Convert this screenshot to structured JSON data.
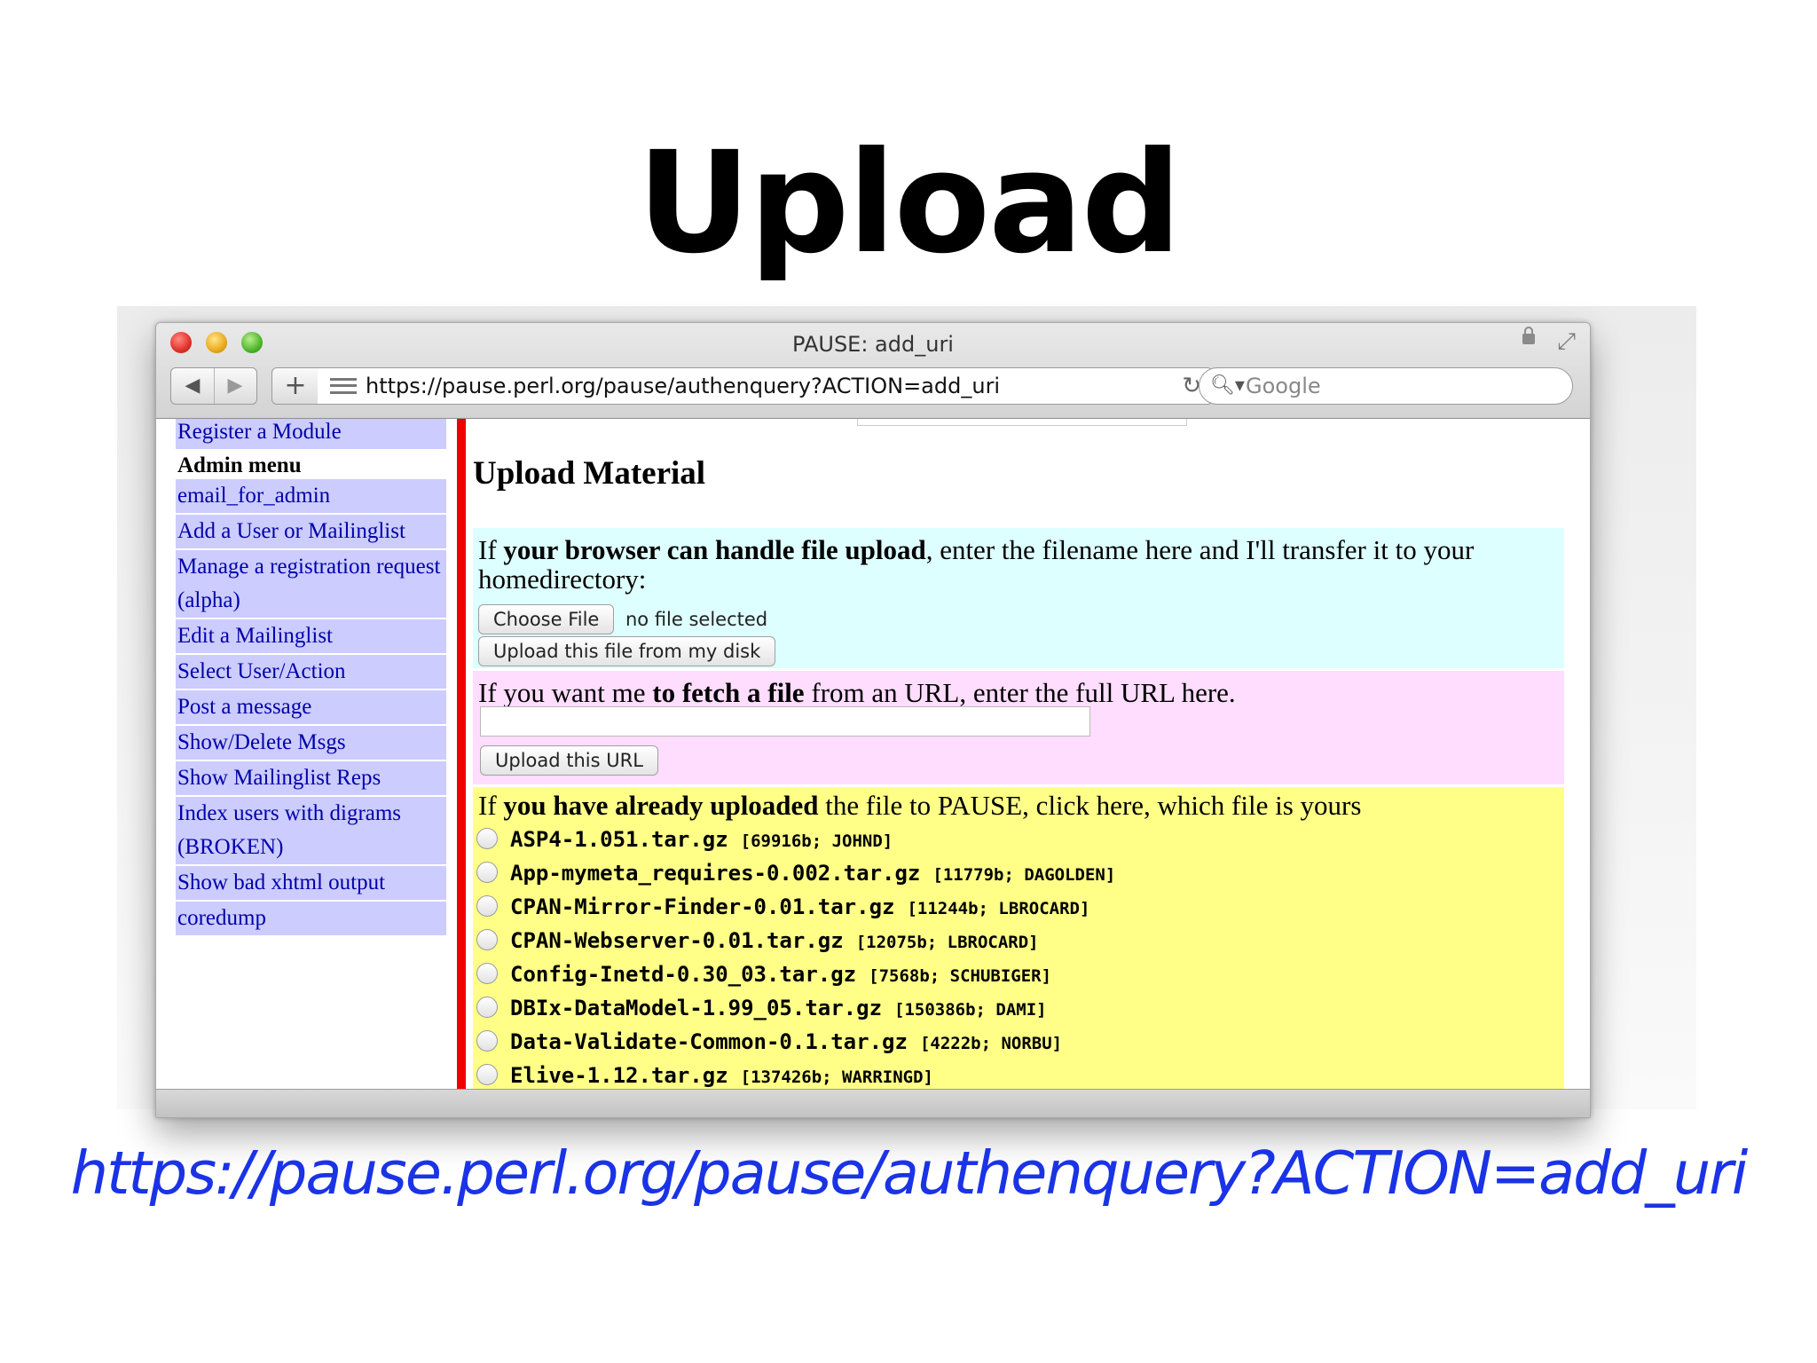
{
  "slide": {
    "title": "Upload",
    "footer_url": "https://pause.perl.org/pause/authenquery?ACTION=add_uri"
  },
  "browser": {
    "window_title": "PAUSE: add_uri",
    "address_url": "https://pause.perl.org/pause/authenquery?ACTION=add_uri",
    "search_placeholder": "Google",
    "icons": {
      "back": "◀",
      "forward": "▶",
      "add": "+",
      "reload": "↻",
      "search": "🔍︎▾",
      "fullscreen": "⤢"
    }
  },
  "sidebar": {
    "items": [
      {
        "label": "Register a Module",
        "type": "link"
      },
      {
        "label": "Admin menu",
        "type": "heading"
      },
      {
        "label": "email_for_admin",
        "type": "link"
      },
      {
        "label": "Add a User or Mailinglist",
        "type": "link"
      },
      {
        "label": "Manage a registration request (alpha)",
        "type": "link"
      },
      {
        "label": "Edit a Mailinglist",
        "type": "link"
      },
      {
        "label": "Select User/Action",
        "type": "link"
      },
      {
        "label": "Post a message",
        "type": "link"
      },
      {
        "label": "Show/Delete Msgs",
        "type": "link"
      },
      {
        "label": "Show Mailinglist Reps",
        "type": "link"
      },
      {
        "label": "Index users with digrams (BROKEN)",
        "type": "link"
      },
      {
        "label": "Show bad xhtml output",
        "type": "link"
      },
      {
        "label": "coredump",
        "type": "link"
      }
    ]
  },
  "main": {
    "heading": "Upload Material",
    "upload_section": {
      "prefix": "If ",
      "bold": "your browser can handle file upload",
      "suffix": ", enter the filename here and I'll transfer it to your homedirectory:",
      "choose_file_label": "Choose File",
      "file_status": "no file selected",
      "upload_button": "Upload this file from my disk"
    },
    "url_section": {
      "prefix": "If you want me ",
      "bold": "to fetch a file",
      "suffix": " from an URL, enter the full URL here.",
      "url_value": "",
      "upload_button": "Upload this URL"
    },
    "uploaded_section": {
      "prefix": "If ",
      "bold": "you have already uploaded",
      "suffix": " the file to PAUSE, click here, which file is yours",
      "files": [
        {
          "name": "ASP4-1.051.tar.gz",
          "meta": "[69916b; JOHND]"
        },
        {
          "name": "App-mymeta_requires-0.002.tar.gz",
          "meta": "[11779b; DAGOLDEN]"
        },
        {
          "name": "CPAN-Mirror-Finder-0.01.tar.gz",
          "meta": "[11244b; LBROCARD]"
        },
        {
          "name": "CPAN-Webserver-0.01.tar.gz",
          "meta": "[12075b; LBROCARD]"
        },
        {
          "name": "Config-Inetd-0.30_03.tar.gz",
          "meta": "[7568b; SCHUBIGER]"
        },
        {
          "name": "DBIx-DataModel-1.99_05.tar.gz",
          "meta": "[150386b; DAMI]"
        },
        {
          "name": "Data-Validate-Common-0.1.tar.gz",
          "meta": "[4222b; NORBU]"
        },
        {
          "name": "Elive-1.12.tar.gz",
          "meta": "[137426b; WARRINGD]"
        }
      ]
    }
  }
}
